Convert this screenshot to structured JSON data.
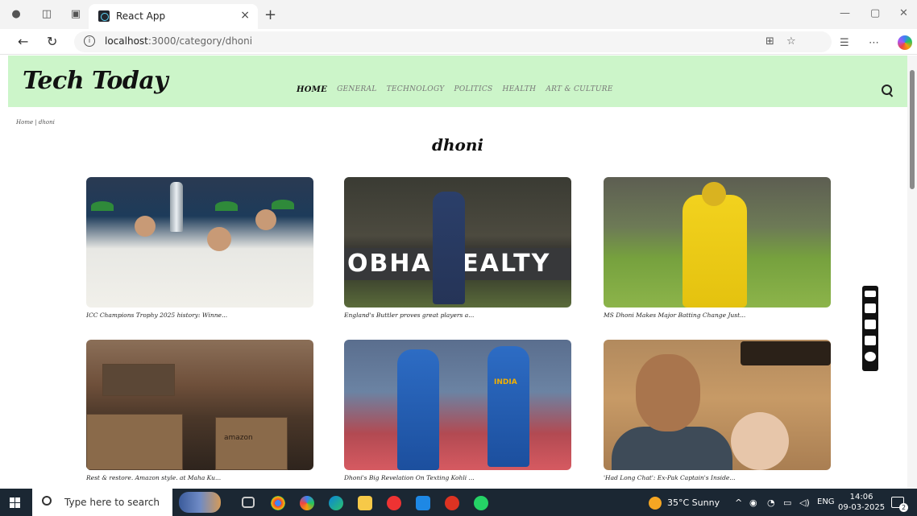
{
  "browser": {
    "tab_title": "React App",
    "close_glyph": "×",
    "new_tab_glyph": "+",
    "url_host": "localhost",
    "url_path": ":3000/category/dhoni"
  },
  "site": {
    "logo": "Tech Today",
    "nav": [
      "HOME",
      "GENERAL",
      "TECHNOLOGY",
      "POLITICS",
      "HEALTH",
      "ART & CULTURE"
    ],
    "active_nav": "HOME",
    "breadcrumb": "Home | dhoni",
    "category_title": "dhoni"
  },
  "cards": [
    {
      "caption": "ICC Champions Trophy 2025 history: Winne..."
    },
    {
      "caption": "England's Buttler proves great players a..."
    },
    {
      "caption": "MS Dhoni Makes Major Batting Change Just..."
    },
    {
      "caption": "Rest & restore. Amazon style. at Maha Ku..."
    },
    {
      "caption": "Dhoni's Big Revelation On Texting Kohli ..."
    },
    {
      "caption": "'Had Long Chat': Ex-Pak Captain's Inside..."
    }
  ],
  "image_text": {
    "banner": "OBHA REALTY",
    "jersey": "INDIA",
    "box_label": "amazon"
  },
  "taskbar": {
    "search_placeholder": "Type here to search",
    "weather": "35°C  Sunny",
    "lang": "ENG",
    "time": "14:06",
    "date": "09-03-2025",
    "notifications": "2"
  }
}
